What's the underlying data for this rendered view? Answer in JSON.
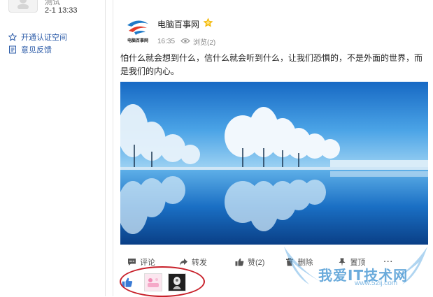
{
  "left": {
    "cut_name": "测试",
    "time": "2-1 13:33",
    "links": [
      {
        "label": "开通认证空间",
        "icon": "star-outline-icon"
      },
      {
        "label": "意见反馈",
        "icon": "feedback-icon"
      }
    ]
  },
  "post": {
    "author": "电脑百事网",
    "logo_text": "电脑百事网",
    "time": "16:35",
    "views": "浏览(2)",
    "text": "怕什么就会想到什么，信什么就会听到什么，让我们恐惧的，不是外面的世界，而是我们的内心。",
    "actions": {
      "comment": "评论",
      "forward": "转发",
      "like": "赞(2)",
      "delete": "删除",
      "top": "置顶",
      "more": "···"
    }
  },
  "watermark": {
    "text": "我爱IT技术网",
    "url": "www.52ij.com"
  },
  "colors": {
    "accent_blue": "#2b5ba8",
    "circle_red": "#c8202a",
    "badge_gold": "#f2b600"
  }
}
